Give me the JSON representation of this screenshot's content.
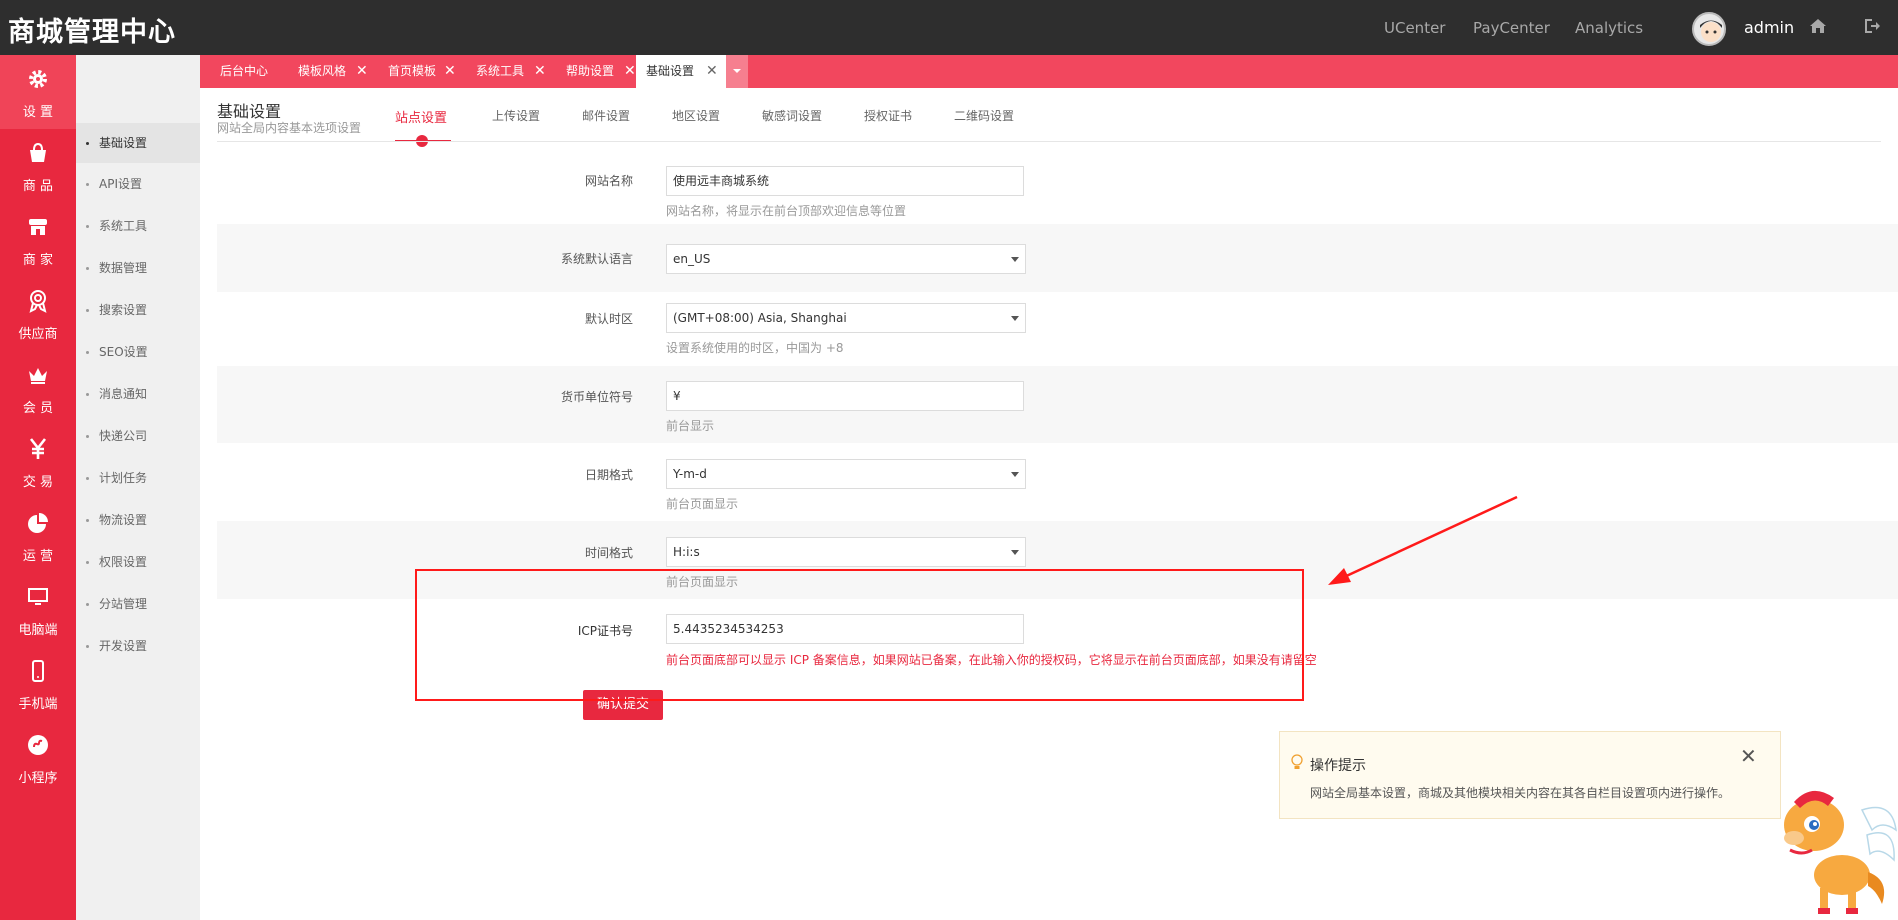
{
  "header": {
    "logo": "商城管理中心",
    "links": [
      "UCenter",
      "PayCenter",
      "Analytics"
    ],
    "user": "admin"
  },
  "leftnav": [
    {
      "label": "设 置",
      "icon": "gear-icon"
    },
    {
      "label": "商 品",
      "icon": "shopping-bag-icon"
    },
    {
      "label": "商 家",
      "icon": "store-icon"
    },
    {
      "label": "供应商",
      "icon": "award-icon"
    },
    {
      "label": "会 员",
      "icon": "crown-icon"
    },
    {
      "label": "交 易",
      "icon": "yen-icon"
    },
    {
      "label": "运 营",
      "icon": "pie-chart-icon"
    },
    {
      "label": "电脑端",
      "icon": "monitor-icon"
    },
    {
      "label": "手机端",
      "icon": "mobile-icon"
    },
    {
      "label": "小程序",
      "icon": "mini-program-icon"
    }
  ],
  "subnav": [
    "基础设置",
    "API设置",
    "系统工具",
    "数据管理",
    "搜索设置",
    "SEO设置",
    "消息通知",
    "快递公司",
    "计划任务",
    "物流设置",
    "权限设置",
    "分站管理",
    "开发设置"
  ],
  "tabs": [
    "后台中心",
    "模板风格",
    "首页模板",
    "系统工具",
    "帮助设置",
    "基础设置"
  ],
  "page": {
    "title": "基础设置",
    "subtitle": "网站全局内容基本选项设置",
    "section_tabs": [
      "站点设置",
      "上传设置",
      "邮件设置",
      "地区设置",
      "敏感词设置",
      "授权证书",
      "二维码设置"
    ]
  },
  "form": {
    "site_name": {
      "label": "网站名称",
      "value": "使用远丰商城系统",
      "hint": "网站名称，将显示在前台顶部欢迎信息等位置"
    },
    "language": {
      "label": "系统默认语言",
      "value": "en_US"
    },
    "timezone": {
      "label": "默认时区",
      "value": "(GMT+08:00) Asia, Shanghai",
      "hint": "设置系统使用的时区，中国为 +8"
    },
    "currency": {
      "label": "货币单位符号",
      "value": "¥",
      "hint": "前台显示"
    },
    "date_format": {
      "label": "日期格式",
      "value": "Y-m-d",
      "hint": "前台页面显示"
    },
    "time_format": {
      "label": "时间格式",
      "value": "H:i:s",
      "hint": "前台页面显示"
    },
    "icp": {
      "label": "ICP证书号",
      "value": "5.4435234534253",
      "hint": "前台页面底部可以显示 ICP 备案信息，如果网站已备案，在此输入你的授权码，它将显示在前台页面底部，如果没有请留空"
    },
    "submit": "确认提交"
  },
  "tips": {
    "title": "操作提示",
    "text": "网站全局基本设置，商城及其他模块相关内容在其各自栏目设置项内进行操作。"
  },
  "colors": {
    "accent": "#e8283f",
    "tabbar": "#f2475e",
    "header": "#2e2e2e"
  }
}
